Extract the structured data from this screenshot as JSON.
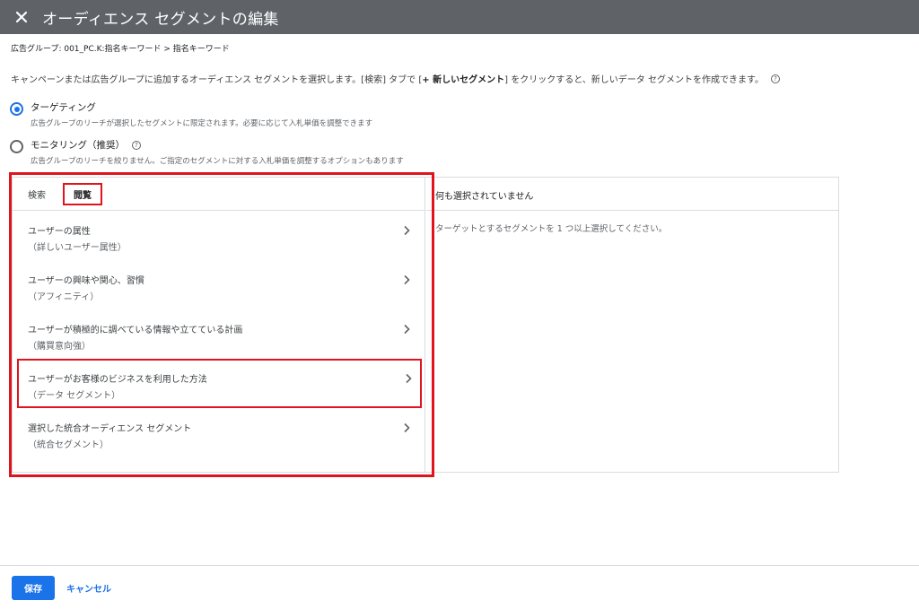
{
  "header": {
    "title": "オーディエンス セグメントの編集",
    "close_icon": "close-icon"
  },
  "breadcrumb": "広告グループ: 001_PC.K:指名キーワード > 指名キーワード",
  "intro": {
    "part1": "キャンペーンまたは広告グループに追加するオーディエンス セグメントを選択します。[検索] タブで [",
    "bold": "+ 新しいセグメント",
    "part2": "] をクリックすると、新しいデータ セグメントを作成できます。"
  },
  "options": [
    {
      "label": "ターゲティング",
      "desc": "広告グループのリーチが選択したセグメントに限定されます。必要に応じて入札単価を調整できます",
      "checked": true
    },
    {
      "label": "モニタリング（推奨）",
      "desc": "広告グループのリーチを絞りません。ご指定のセグメントに対する入札単価を調整するオプションもあります",
      "checked": false
    }
  ],
  "tabs": {
    "search": "検索",
    "browse": "閲覧"
  },
  "categories": [
    {
      "title": "ユーザーの属性",
      "sub": "（詳しいユーザー属性）"
    },
    {
      "title": "ユーザーの興味や関心、習慣",
      "sub": "（アフィニティ）"
    },
    {
      "title": "ユーザーが積極的に調べている情報や立てている計画",
      "sub": "（購買意向強）"
    },
    {
      "title": "ユーザーがお客様のビジネスを利用した方法",
      "sub": "（データ セグメント）"
    },
    {
      "title": "選択した統合オーディエンス セグメント",
      "sub": "（統合セグメント）"
    }
  ],
  "selection": {
    "heading": "何も選択されていません",
    "hint": "ターゲットとするセグメントを 1 つ以上選択してください。"
  },
  "footer": {
    "save": "保存",
    "cancel": "キャンセル"
  },
  "colors": {
    "header_bg": "#5f6368",
    "accent": "#1a73e8",
    "highlight": "#e0141c"
  }
}
